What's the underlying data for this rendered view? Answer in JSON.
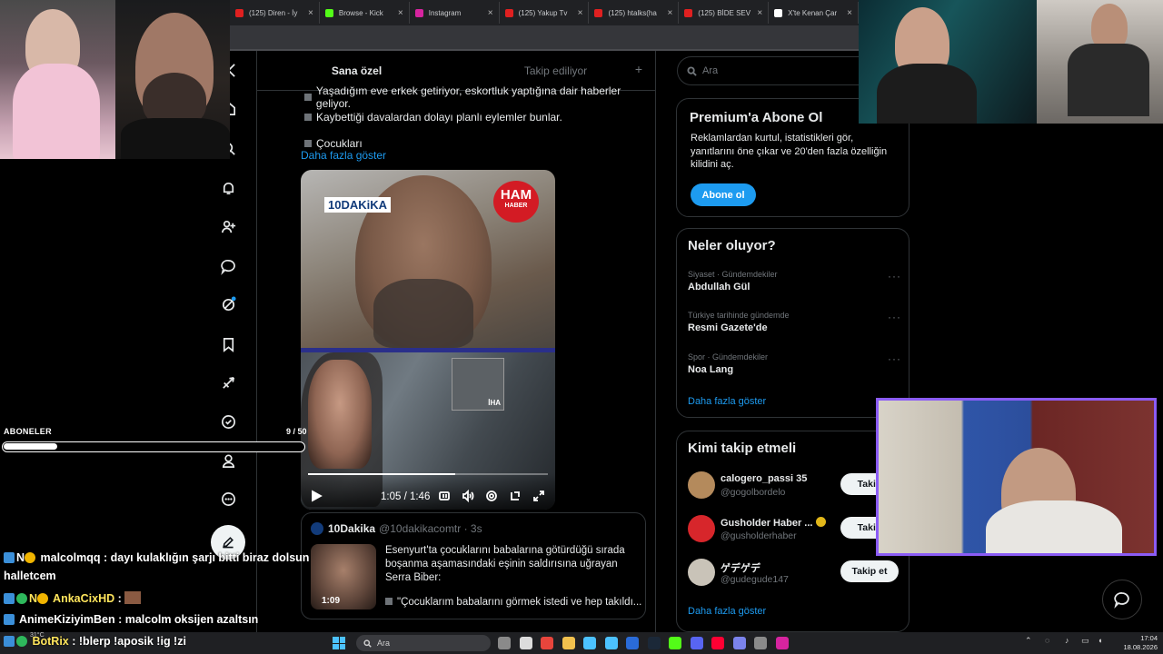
{
  "browser": {
    "tabs": [
      {
        "title": "(125) Diren - İy",
        "color": "#e02020"
      },
      {
        "title": "Browse - Kick",
        "color": "#53fc18"
      },
      {
        "title": "Instagram",
        "color": "#d6249f"
      },
      {
        "title": "(125) Yakup Tv",
        "color": "#e02020"
      },
      {
        "title": "(125) htalks(ha",
        "color": "#e02020"
      },
      {
        "title": "(125) BİDE SEV",
        "color": "#e02020"
      },
      {
        "title": "X'te Kenan Çar",
        "color": "#ffffff"
      }
    ]
  },
  "feed": {
    "tabs": [
      "Sana özel",
      "Takip ediliyor"
    ],
    "post_lines": [
      "Yaşadığım eve erkek getiriyor, eskortluk yaptığına dair haberler geliyor.",
      "Kaybettiği davalardan dolayı planlı eylemler bunlar.",
      "Çocukları"
    ],
    "show_more": "Daha fazla göster",
    "video": {
      "brand_left": "10DAKiKA",
      "brand_right_main": "HAM",
      "brand_right_sub": "HABER",
      "inset_label": "İHA",
      "time": "1:05 / 1:46",
      "progress": 0.615
    },
    "quote": {
      "name": "10Dakika",
      "handle": "@10dakikacomtr · 3s",
      "duration": "1:09",
      "text": "Esenyurt'ta çocuklarını babalarına götürdüğü sırada boşanma aşamasındaki eşinin saldırısına uğrayan Serra Biber:",
      "text2": "\"Çocuklarım babalarını görmek istedi ve hep takıldı..."
    }
  },
  "sidebar": {
    "search_placeholder": "Ara",
    "premium": {
      "title": "Premium'a Abone Ol",
      "desc": "Reklamlardan kurtul, istatistikleri gör, yanıtlarını öne çıkar ve 20'den fazla özelliğin kilidini aç.",
      "button": "Abone ol"
    },
    "trends": {
      "title": "Neler oluyor?",
      "items": [
        {
          "meta": "Siyaset · Gündemdekiler",
          "name": "Abdullah Gül"
        },
        {
          "meta": "Türkiye tarihinde gündemde",
          "name": "Resmi Gazete'de"
        },
        {
          "meta": "Spor · Gündemdekiler",
          "name": "Noa Lang"
        }
      ],
      "more": "Daha fazla göster"
    },
    "who_to_follow": {
      "title": "Kimi takip etmeli",
      "items": [
        {
          "name": "calogero_passi 35",
          "handle": "@gogolbordelo",
          "button": "Takip",
          "avatar": "#b48a5c"
        },
        {
          "name": "Gusholder Haber ...",
          "handle": "@gusholderhaber",
          "button": "Takip",
          "avatar": "#d7262b"
        },
        {
          "name": "ゲデゲデ",
          "handle": "@gudegude147",
          "button": "Takip et",
          "avatar": "#c9c3b8"
        }
      ],
      "more": "Daha fazla göster"
    }
  },
  "overlay": {
    "subs_label": "ABONELER",
    "subs_count": "9 / 50",
    "subs_progress": 0.18,
    "chat": [
      {
        "user": "malcolmqq",
        "message": " : dayı kulaklığın şarjı bitti biraz dolsun",
        "color": "u-white"
      },
      {
        "user": "",
        "message": "halletcem",
        "color": "u-white"
      },
      {
        "user": "AnkaCixHD",
        "message": " : ",
        "color": "u-yellow"
      },
      {
        "user": "AnimeKiziyimBen",
        "message": " : malcolm oksijen azaltsın",
        "color": "u-white"
      },
      {
        "user": "BotRix",
        "message": " : !blerp !aposik !ig !zi",
        "color": "u-yellow"
      }
    ]
  },
  "taskbar": {
    "weather": "31°C",
    "search_placeholder": "Ara",
    "time": "17:04",
    "date": "18.08.2026",
    "apps": [
      "#8a8a8a",
      "#dcdcdc",
      "#e8453c",
      "#f2c14e",
      "#4cc2ff",
      "#4cc2ff",
      "#2a6bd8",
      "#1b2838",
      "#53fc18",
      "#5865f2",
      "#ff0033",
      "#7b83eb",
      "#8a8a8a",
      "#d6249f"
    ]
  }
}
